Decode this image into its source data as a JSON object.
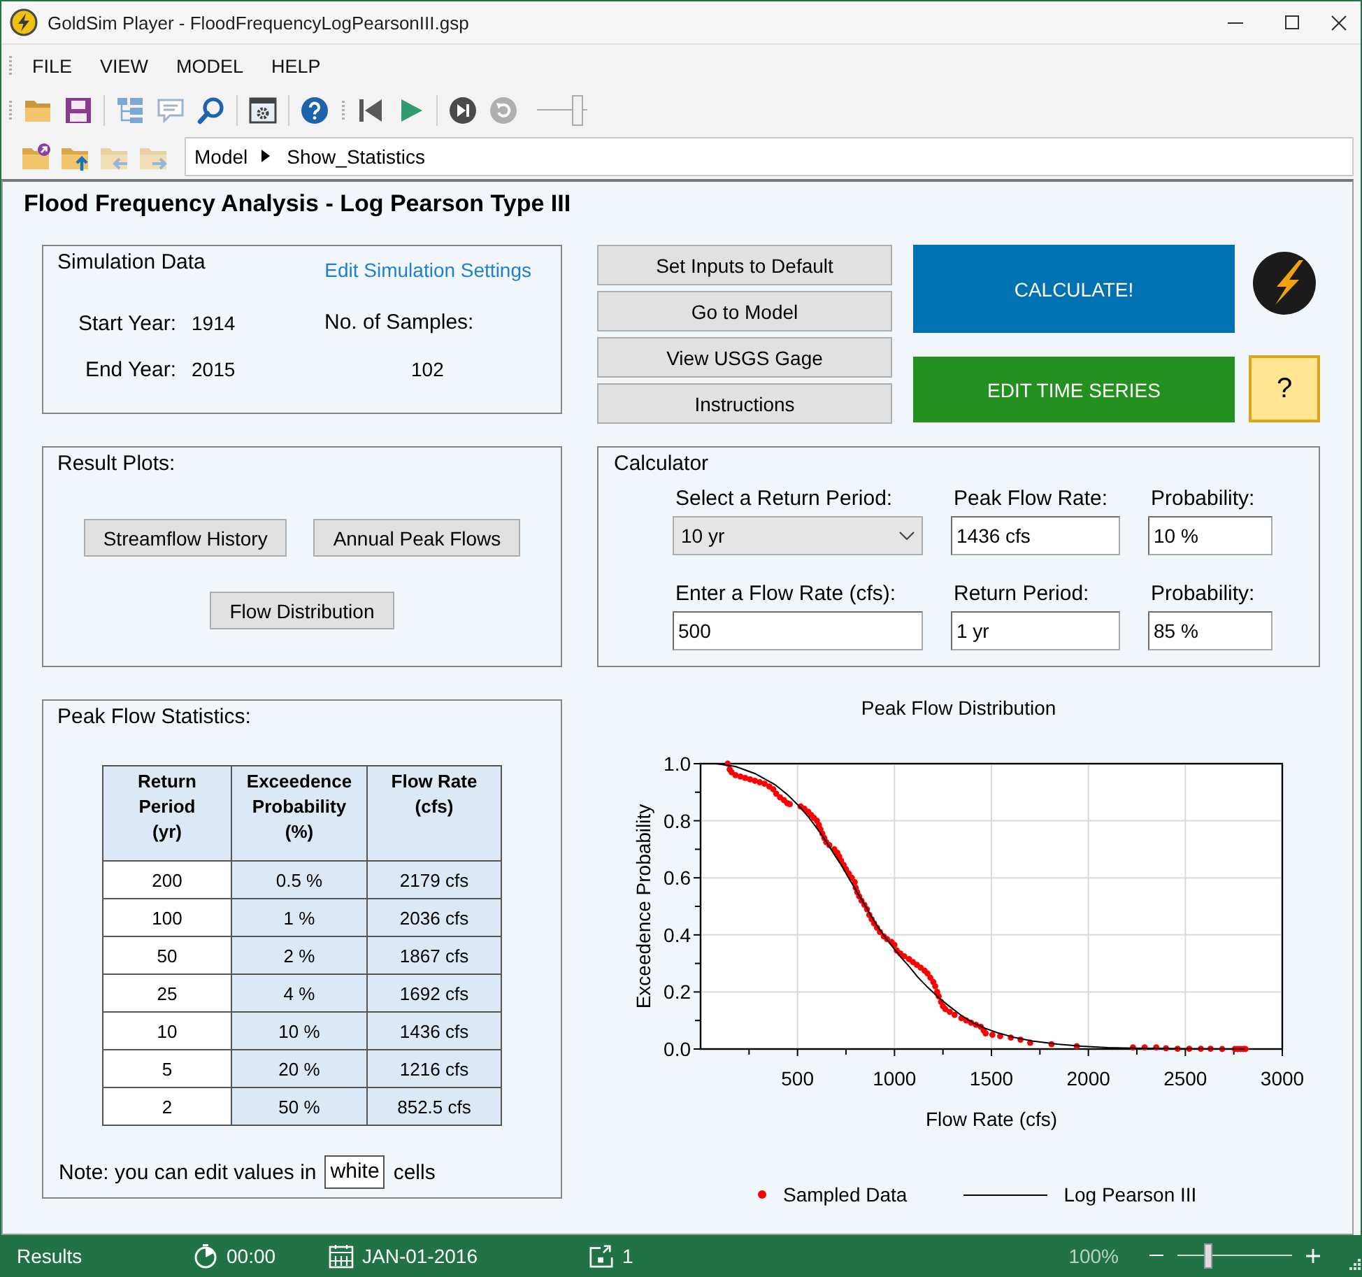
{
  "window": {
    "title": "GoldSim Player - FloodFrequencyLogPearsonIII.gsp"
  },
  "menu": [
    "FILE",
    "VIEW",
    "MODEL",
    "HELP"
  ],
  "toolbar": {
    "bars": [
      {
        "groups": [
          [
            {
              "kind": "open",
              "disabled": false
            },
            {
              "kind": "save",
              "disabled": false
            }
          ],
          [
            {
              "kind": "tree",
              "disabled": false
            },
            {
              "kind": "comment",
              "disabled": false
            },
            {
              "kind": "search",
              "disabled": false
            }
          ],
          [
            {
              "kind": "settings",
              "disabled": false
            }
          ],
          [
            {
              "kind": "help",
              "disabled": false
            }
          ]
        ]
      },
      {
        "groups": [
          [
            {
              "kind": "skip_back",
              "disabled": false
            },
            {
              "kind": "play",
              "disabled": false
            }
          ],
          [
            {
              "kind": "step",
              "disabled": false
            },
            {
              "kind": "reset",
              "disabled": true
            },
            {
              "kind": "slider",
              "disabled": true,
              "level": 0.8
            }
          ]
        ]
      }
    ]
  },
  "navigation": [
    {
      "kind": "home",
      "disabled": false
    },
    {
      "kind": "up",
      "disabled": false
    },
    {
      "kind": "back",
      "disabled": true
    },
    {
      "kind": "forward",
      "disabled": true
    }
  ],
  "breadcrumb": [
    "Model",
    "Show_Statistics"
  ],
  "page_title": "Flood Frequency Analysis - Log Pearson Type III",
  "simulation_data": {
    "title": "Simulation Data",
    "link": "Edit Simulation Settings",
    "fields": [
      {
        "label": "Start Year:",
        "value": "1914"
      },
      {
        "label": "End Year:",
        "value": "2015"
      }
    ],
    "samples": {
      "label": "No. of Samples:",
      "value": "102"
    }
  },
  "actions": [
    "Set Inputs to Default",
    "Go to Model",
    "View USGS Gage",
    "Instructions"
  ],
  "calculate_button": "CALCULATE!",
  "edit_time_series_button": "EDIT TIME SERIES",
  "help_button": "?",
  "result_plots": {
    "title": "Result Plots:",
    "buttons": [
      "Streamflow History",
      "Annual Peak Flows",
      "Flow Distribution"
    ]
  },
  "calculator": {
    "title": "Calculator",
    "rows": [
      {
        "fields": [
          {
            "kind": "dropdown",
            "label": "Select a Return Period:",
            "value": "10 yr"
          },
          {
            "kind": "input",
            "label": "Peak Flow Rate:",
            "value": "1436 cfs"
          },
          {
            "kind": "input",
            "label": "Probability:",
            "value": "10 %"
          }
        ]
      },
      {
        "fields": [
          {
            "kind": "input",
            "label": "Enter a Flow Rate (cfs):",
            "value": "500"
          },
          {
            "kind": "input",
            "label": "Return Period:",
            "value": "1 yr"
          },
          {
            "kind": "input",
            "label": "Probability:",
            "value": "85 %"
          }
        ]
      }
    ]
  },
  "statistics": {
    "title": "Peak Flow Statistics:",
    "columns": [
      {
        "label": "Return\nPeriod\n(yr)",
        "editable": true
      },
      {
        "label": "Exceedence\nProbability\n(%)",
        "editable": false
      },
      {
        "label": "Flow Rate\n(cfs)",
        "editable": false
      }
    ],
    "rows": [
      [
        "200",
        "0.5 %",
        "2179 cfs"
      ],
      [
        "100",
        "1 %",
        "2036 cfs"
      ],
      [
        "50",
        "2 %",
        "1867 cfs"
      ],
      [
        "25",
        "4 %",
        "1692 cfs"
      ],
      [
        "10",
        "10 %",
        "1436 cfs"
      ],
      [
        "5",
        "20 %",
        "1216 cfs"
      ],
      [
        "2",
        "50 %",
        "852.5 cfs"
      ]
    ],
    "note": {
      "text": "Note: you can edit values in",
      "sample": "white",
      "after": "cells"
    }
  },
  "chart": {
    "chart_data": {
      "type": "scatter",
      "title": "Peak Flow Distribution",
      "xlabel": "Flow Rate (cfs)",
      "ylabel": "Exceedence Probability",
      "grid": true,
      "legend": "bottom",
      "xlim": [
        0,
        3000
      ],
      "ylim": [
        0,
        1
      ],
      "xticks": [
        500,
        1000,
        1500,
        2000,
        2500,
        3000
      ],
      "yticks": [
        {
          "value": 0,
          "label": "0.0"
        },
        {
          "value": 0.2,
          "label": "0.2"
        },
        {
          "value": 0.4,
          "label": "0.4"
        },
        {
          "value": 0.6,
          "label": "0.6"
        },
        {
          "value": 0.8,
          "label": "0.8"
        },
        {
          "value": 1,
          "label": "1.0"
        }
      ],
      "series": [
        {
          "name": "Sampled Data",
          "color": "#ff0000",
          "x": [
            140,
            150,
            160,
            180,
            205,
            230,
            255,
            280,
            305,
            330,
            355,
            375,
            390,
            410,
            430,
            447,
            460,
            516,
            535,
            555,
            570,
            585,
            600,
            610,
            618,
            628,
            638,
            648,
            664,
            690,
            705,
            715,
            725,
            738,
            750,
            765,
            780,
            795,
            800,
            808,
            818,
            830,
            845,
            858,
            870,
            882,
            895,
            910,
            925,
            945,
            962,
            985,
            1000,
            1012,
            1030,
            1050,
            1075,
            1095,
            1115,
            1135,
            1155,
            1170,
            1185,
            1200,
            1210,
            1220,
            1228,
            1240,
            1250,
            1262,
            1285,
            1310,
            1345,
            1370,
            1395,
            1420,
            1445,
            1460,
            1470,
            1505,
            1545,
            1600,
            1650,
            1700,
            1810,
            1940,
            2230,
            2290,
            2350,
            2400,
            2460,
            2520,
            2580,
            2630,
            2690,
            2755,
            2770,
            2785,
            2800,
            2810
          ],
          "values": [
            1.0,
            0.98,
            0.97,
            0.96,
            0.955,
            0.95,
            0.945,
            0.94,
            0.935,
            0.93,
            0.92,
            0.91,
            0.895,
            0.882,
            0.872,
            0.862,
            0.858,
            0.85,
            0.842,
            0.832,
            0.82,
            0.81,
            0.8,
            0.785,
            0.77,
            0.755,
            0.74,
            0.725,
            0.715,
            0.7,
            0.688,
            0.675,
            0.66,
            0.645,
            0.63,
            0.615,
            0.6,
            0.585,
            0.565,
            0.55,
            0.535,
            0.52,
            0.505,
            0.49,
            0.47,
            0.455,
            0.44,
            0.425,
            0.41,
            0.395,
            0.385,
            0.375,
            0.365,
            0.345,
            0.335,
            0.325,
            0.315,
            0.305,
            0.295,
            0.285,
            0.275,
            0.265,
            0.25,
            0.235,
            0.22,
            0.2,
            0.185,
            0.165,
            0.15,
            0.14,
            0.13,
            0.12,
            0.108,
            0.1,
            0.092,
            0.085,
            0.078,
            0.065,
            0.055,
            0.05,
            0.045,
            0.04,
            0.033,
            0.022,
            0.017,
            0.01,
            0.006,
            0.006,
            0.006,
            0.003,
            0.001,
            0.001,
            0.001,
            0.001,
            0.0,
            0.0,
            0.0,
            0.0,
            0.0,
            0.0
          ]
        },
        {
          "name": "Log Pearson III",
          "type": "line",
          "color": "#000000",
          "x": [
            80,
            180,
            281,
            383,
            450,
            511,
            560,
            613,
            650,
            689,
            730,
            766,
            805,
            842,
            880,
            919,
            960,
            996,
            1035,
            1072,
            1120,
            1174,
            1225,
            1277,
            1340,
            1404,
            1470,
            1532,
            1620,
            1710,
            1840,
            1966,
            2100,
            2221,
            2476,
            2808
          ],
          "values": [
            1.0,
            0.99,
            0.965,
            0.927,
            0.89,
            0.849,
            0.81,
            0.762,
            0.725,
            0.683,
            0.64,
            0.597,
            0.553,
            0.51,
            0.466,
            0.423,
            0.385,
            0.353,
            0.32,
            0.292,
            0.252,
            0.214,
            0.182,
            0.153,
            0.12,
            0.092,
            0.072,
            0.057,
            0.04,
            0.028,
            0.017,
            0.01,
            0.005,
            0.003,
            0.001,
            0.0
          ]
        }
      ]
    }
  },
  "status_bar": {
    "label": "Results",
    "time": "00:00",
    "date": "JAN-01-2016",
    "count": "1",
    "zoom": "100%",
    "zoom_slider": {
      "level": 0.27
    }
  }
}
